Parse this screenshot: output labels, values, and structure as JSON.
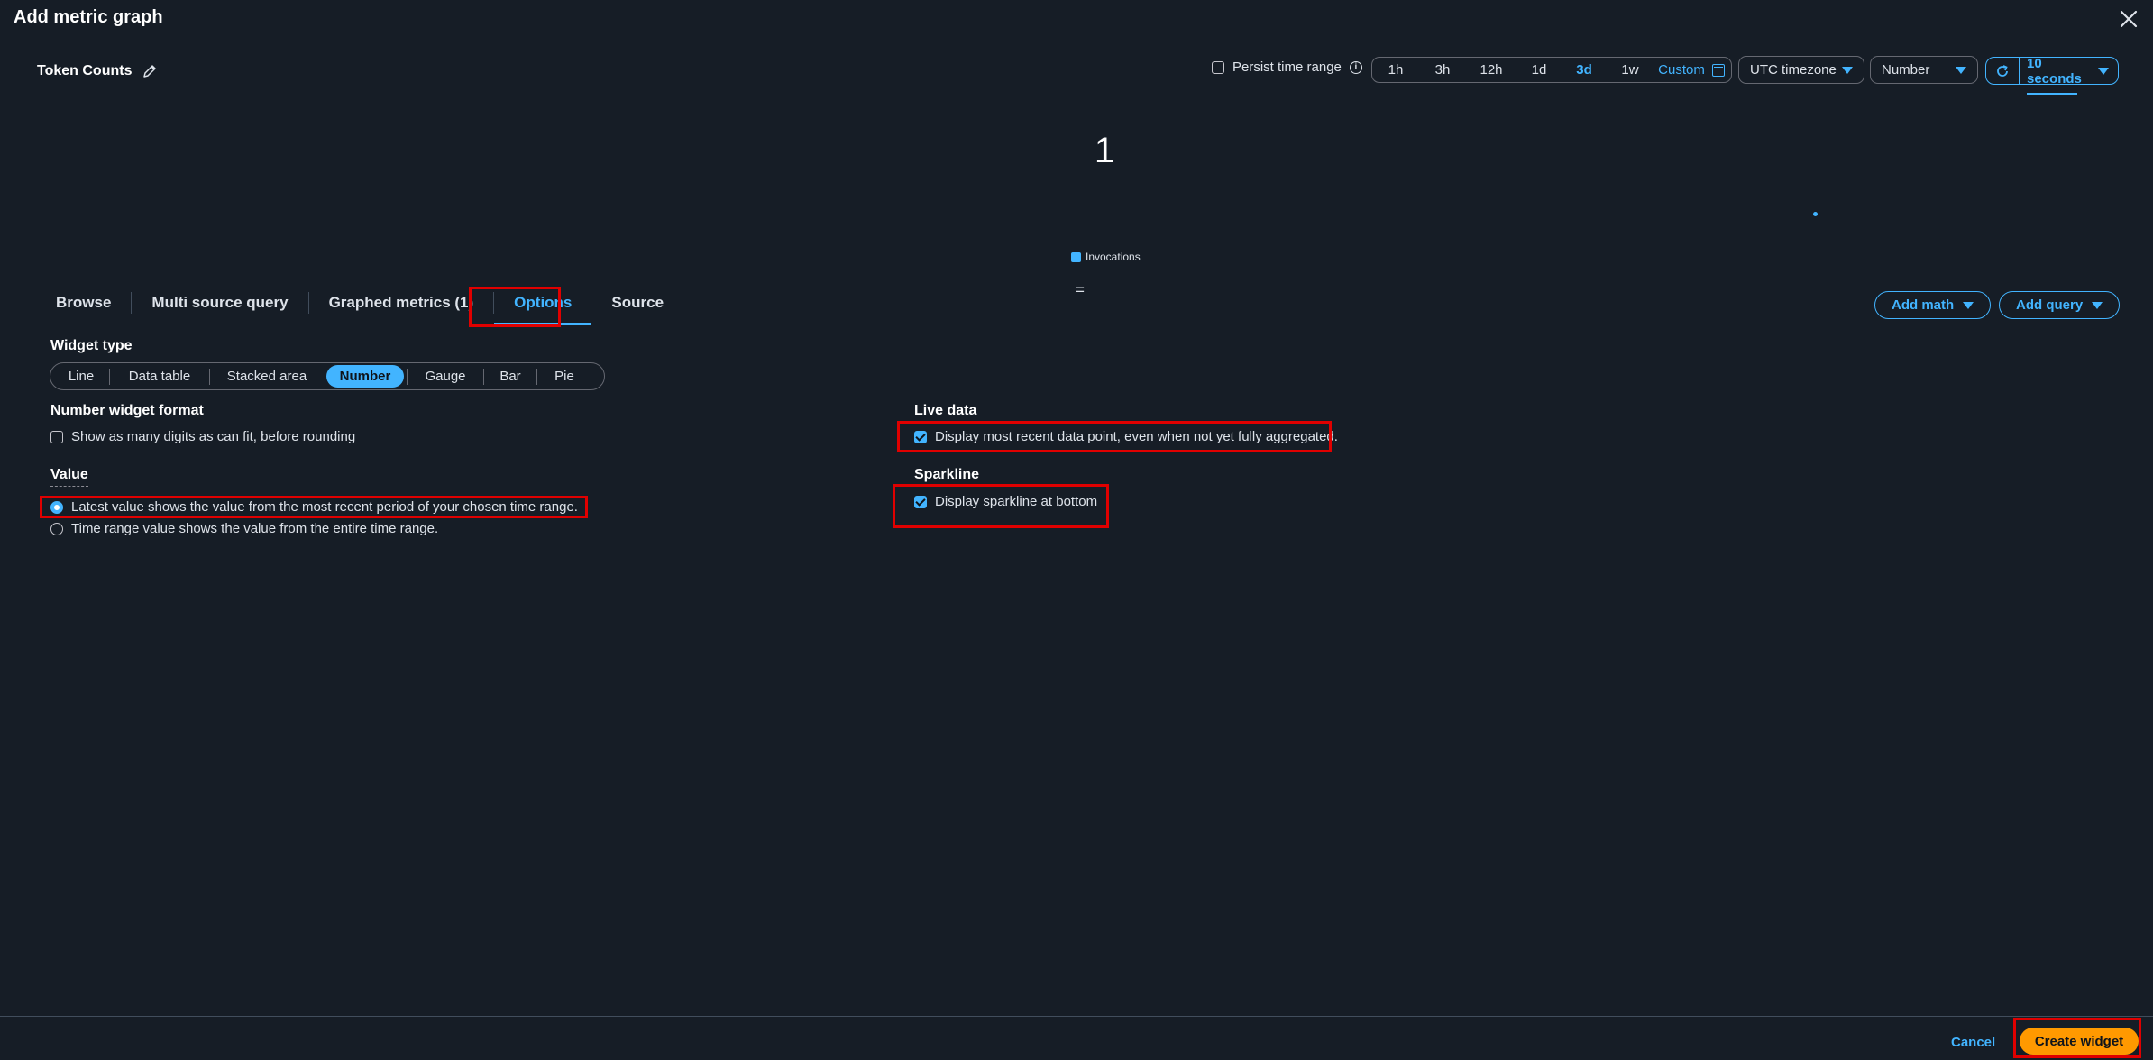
{
  "modal": {
    "title": "Add metric graph"
  },
  "graph": {
    "title": "Token Counts",
    "value": "1",
    "legend": "Invocations",
    "equals": "="
  },
  "toolbar": {
    "persist_label": "Persist time range",
    "ranges": [
      "1h",
      "3h",
      "12h",
      "1d",
      "3d",
      "1w"
    ],
    "active_range": "3d",
    "custom_label": "Custom",
    "timezone": "UTC timezone",
    "widget_type_select": "Number",
    "refresh": "10 seconds"
  },
  "tabs": [
    "Browse",
    "Multi source query",
    "Graphed metrics (1)",
    "Options",
    "Source"
  ],
  "active_tab": "Options",
  "actions": {
    "add_math": "Add math",
    "add_query": "Add query"
  },
  "options": {
    "widget_type_label": "Widget type",
    "widget_types": [
      "Line",
      "Data table",
      "Stacked area",
      "Number",
      "Gauge",
      "Bar",
      "Pie"
    ],
    "selected_widget_type": "Number",
    "number_format_label": "Number widget format",
    "number_format_option": "Show as many digits as can fit, before rounding",
    "value_label": "Value",
    "value_latest": "Latest value shows the value from the most recent period of your chosen time range.",
    "value_range": "Time range value shows the value from the entire time range.",
    "live_data_label": "Live data",
    "live_data_option": "Display most recent data point, even when not yet fully aggregated.",
    "sparkline_label": "Sparkline",
    "sparkline_option": "Display sparkline at bottom"
  },
  "footer": {
    "cancel": "Cancel",
    "create": "Create widget"
  },
  "colors": {
    "background": "#161d26",
    "accent": "#42b4ff",
    "primary_button": "#ff9900",
    "highlight": "#e00000"
  }
}
